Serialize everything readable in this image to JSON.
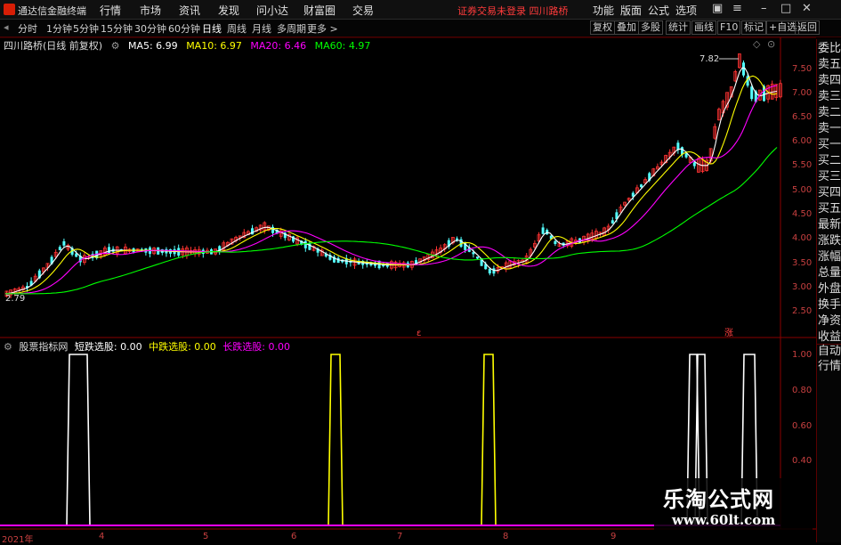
{
  "app": {
    "title": "通达信金融终端",
    "login_status": "证券交易未登录",
    "stock_name": "四川路桥"
  },
  "menu": [
    "行情",
    "市场",
    "资讯",
    "发现",
    "问小达",
    "财富圈",
    "交易"
  ],
  "right_menu": [
    "功能",
    "版面",
    "公式",
    "选项"
  ],
  "periods": [
    "分时",
    "1分钟",
    "5分钟",
    "15分钟",
    "30分钟",
    "60分钟",
    "日线",
    "周线",
    "月线",
    "多周期",
    "更多 >"
  ],
  "active_period": "日线",
  "tools": [
    "复权",
    "叠加",
    "多股",
    "统计",
    "画线",
    "F10",
    "标记",
    "+自选",
    "返回"
  ],
  "price_info": {
    "title": "四川路桥(日线 前复权)",
    "ma5": "MA5: 6.99",
    "ma10": "MA10: 6.97",
    "ma20": "MA20: 6.46",
    "ma60": "MA60: 4.97",
    "colors": {
      "ma5": "#ffffff",
      "ma10": "#ffff00",
      "ma20": "#ff00ff",
      "ma60": "#00ff00"
    }
  },
  "indicator_info": {
    "title": "股票指标网",
    "short": "短跌选股: 0.00",
    "mid": "中跌选股: 0.00",
    "long": "长跌选股: 0.00",
    "colors": {
      "short": "#ffffff",
      "mid": "#ffff00",
      "long": "#ff00ff"
    }
  },
  "price_axis": [
    "7.50",
    "7.00",
    "6.50",
    "6.00",
    "5.50",
    "5.00",
    "4.50",
    "4.00",
    "3.50",
    "3.00",
    "2.50"
  ],
  "indicator_axis": [
    "1.00",
    "0.80",
    "0.60",
    "0.40"
  ],
  "dates": [
    "2021年",
    "4",
    "5",
    "6",
    "7",
    "8",
    "9"
  ],
  "high_annotation": "7.82",
  "low_annotation": "2.79",
  "side_items": [
    "委比",
    "卖五",
    "卖四",
    "卖三",
    "卖二",
    "卖一",
    "买一",
    "买二",
    "买三",
    "买四",
    "买五",
    "最新",
    "涨跌",
    "涨幅",
    "总量",
    "外盘",
    "换手",
    "净资",
    "收益",
    "自动",
    "行情"
  ],
  "watermark": {
    "cn": "乐淘公式网",
    "url": "www.60lt.com"
  },
  "marker_glyph": "涨"
}
